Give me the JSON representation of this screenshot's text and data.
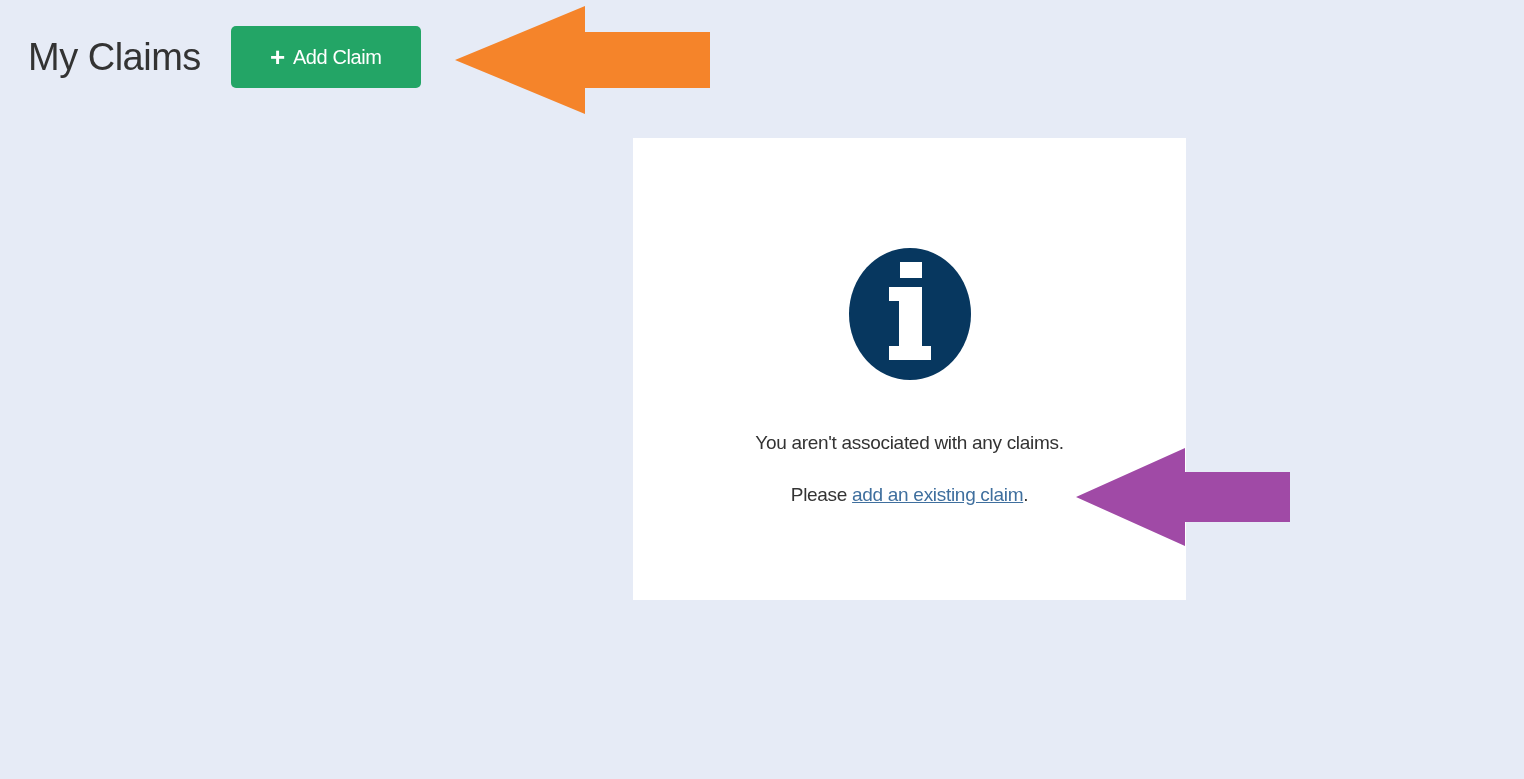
{
  "header": {
    "title": "My Claims",
    "add_button": {
      "icon": "+",
      "label": "Add Claim"
    }
  },
  "empty_state": {
    "message": "You aren't associated with any claims.",
    "prompt": {
      "before": "Please ",
      "link": "add an existing claim",
      "after": "."
    }
  },
  "annotations": [
    {
      "kind": "arrow",
      "color": "#f5842a"
    },
    {
      "kind": "arrow",
      "color": "#a04aa6"
    }
  ]
}
